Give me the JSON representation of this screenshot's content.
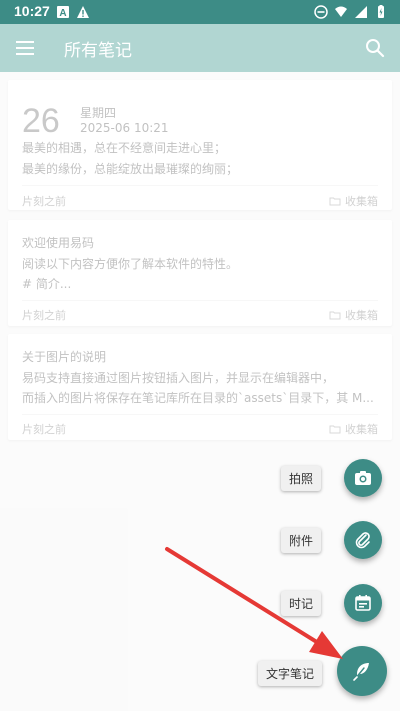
{
  "status_bar": {
    "time": "10:27",
    "icons": [
      "notification-a-icon",
      "warning-icon",
      "dnd-icon",
      "wifi-icon",
      "signal-icon",
      "battery-icon"
    ]
  },
  "app_bar": {
    "title": "所有笔记",
    "menu_icon": "menu-icon",
    "search_icon": "search-icon"
  },
  "notes": [
    {
      "day": "26",
      "weekday": "星期四",
      "datetime": "2025-06  10:21",
      "lines": [
        "最美的相遇，总在不经意间走进心里；",
        "最美的缘份，总能绽放出最璀璨的绚丽；"
      ],
      "time_ago": "片刻之前",
      "folder": "收集箱"
    },
    {
      "title": "欢迎使用易码",
      "lines": [
        "阅读以下内容方便你了解本软件的特性。",
        "# 简介..."
      ],
      "time_ago": "片刻之前",
      "folder": "收集箱"
    },
    {
      "title": "关于图片的说明",
      "lines": [
        "易码支持直接通过图片按钮插入图片，并显示在编辑器中，",
        "而插入的图片将保存在笔记库所在目录的`assets`目录下，其 M..."
      ],
      "time_ago": "片刻之前",
      "folder": "收集箱"
    }
  ],
  "fab_menu": {
    "photo_label": "拍照",
    "attachment_label": "附件",
    "time_note_label": "时记",
    "text_note_label": "文字笔记"
  },
  "colors": {
    "status_bar": "#3d8c86",
    "app_bar": "#52a59c",
    "fab": "#3d8c86",
    "arrow": "#e53935"
  }
}
